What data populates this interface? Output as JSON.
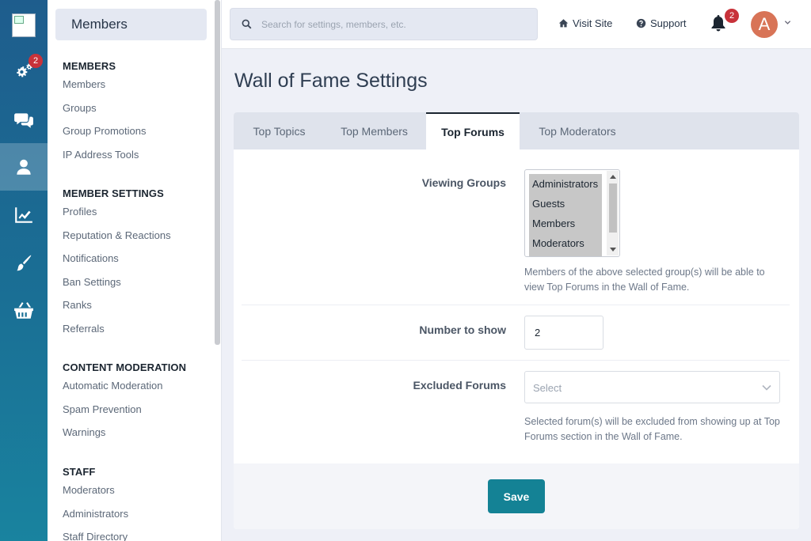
{
  "rail": {
    "items": [
      {
        "name": "settings",
        "badge": "2"
      },
      {
        "name": "community"
      },
      {
        "name": "members"
      },
      {
        "name": "stats"
      },
      {
        "name": "customization"
      },
      {
        "name": "marketplace"
      }
    ]
  },
  "sidebar": {
    "title": "Members",
    "sections": [
      {
        "heading": "MEMBERS",
        "items": [
          "Members",
          "Groups",
          "Group Promotions",
          "IP Address Tools"
        ]
      },
      {
        "heading": "MEMBER SETTINGS",
        "items": [
          "Profiles",
          "Reputation & Reactions",
          "Notifications",
          "Ban Settings",
          "Ranks",
          "Referrals"
        ]
      },
      {
        "heading": "CONTENT MODERATION",
        "items": [
          "Automatic Moderation",
          "Spam Prevention",
          "Warnings"
        ]
      },
      {
        "heading": "STAFF",
        "items": [
          "Moderators",
          "Administrators",
          "Staff Directory"
        ]
      }
    ]
  },
  "header": {
    "search_placeholder": "Search for settings, members, etc.",
    "visit_site": "Visit Site",
    "support": "Support",
    "notifications_badge": "2",
    "avatar_letter": "A"
  },
  "main": {
    "title": "Wall of Fame Settings",
    "tabs": [
      "Top Topics",
      "Top Members",
      "Top Forums",
      "Top Moderators"
    ],
    "active_tab": "Top Forums",
    "viewing_groups": {
      "label": "Viewing Groups",
      "options": [
        "Administrators",
        "Guests",
        "Members",
        "Moderators"
      ],
      "description": "Members of the above selected group(s) will be able to view Top Forums in the Wall of Fame."
    },
    "number_to_show": {
      "label": "Number to show",
      "value": "2"
    },
    "excluded_forums": {
      "label": "Excluded Forums",
      "placeholder": "Select",
      "description": "Selected forum(s) will be excluded from showing up at Top Forums section in the Wall of Fame."
    },
    "save_label": "Save"
  },
  "colors": {
    "accent": "#148295",
    "rail_top": "#1e5d8d",
    "badge": "#c8323a",
    "avatar": "#d87457"
  }
}
